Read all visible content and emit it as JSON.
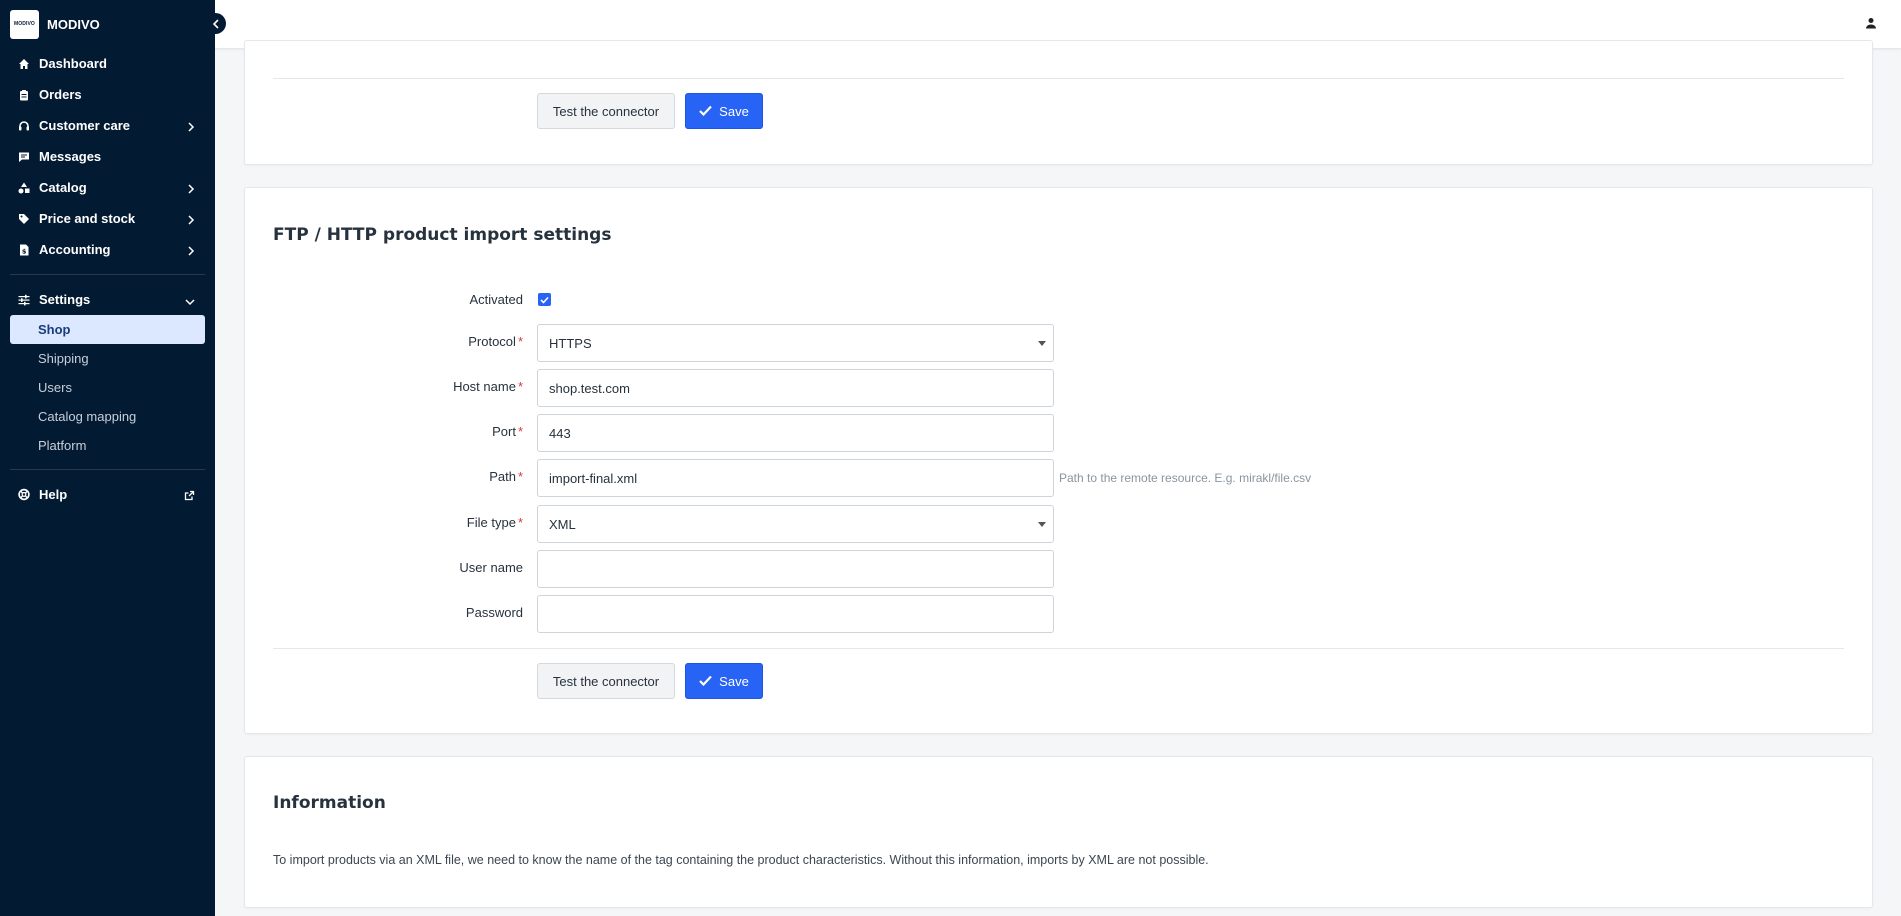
{
  "brand": {
    "logo_text": "MODIVO",
    "name": "MODIVO"
  },
  "nav": {
    "dashboard": "Dashboard",
    "orders": "Orders",
    "customer_care": "Customer care",
    "messages": "Messages",
    "catalog": "Catalog",
    "price_stock": "Price and stock",
    "accounting": "Accounting",
    "settings": "Settings",
    "settings_items": [
      "Shop",
      "Shipping",
      "Users",
      "Catalog mapping",
      "Platform"
    ],
    "help": "Help"
  },
  "card1": {
    "test_label": "Test the connector",
    "save_label": "Save"
  },
  "import_settings": {
    "title": "FTP / HTTP product import settings",
    "activated_label": "Activated",
    "activated": true,
    "protocol_label": "Protocol",
    "protocol_value": "HTTPS",
    "host_label": "Host name",
    "host_value": "shop.test.com",
    "port_label": "Port",
    "port_value": "443",
    "path_label": "Path",
    "path_value": "import-final.xml",
    "path_help": "Path to the remote resource. E.g. mirakl/file.csv",
    "filetype_label": "File type",
    "filetype_value": "XML",
    "username_label": "User name",
    "username_value": "",
    "password_label": "Password",
    "password_value": "",
    "required_mark": "*",
    "test_label": "Test the connector",
    "save_label": "Save"
  },
  "information": {
    "title": "Information",
    "text": "To import products via an XML file, we need to know the name of the tag containing the product characteristics. Without this information, imports by XML are not possible."
  },
  "colors": {
    "sidebar": "#031a33",
    "primary": "#2764f5",
    "active_bg": "#dce8ff",
    "required": "#d63a3a"
  }
}
